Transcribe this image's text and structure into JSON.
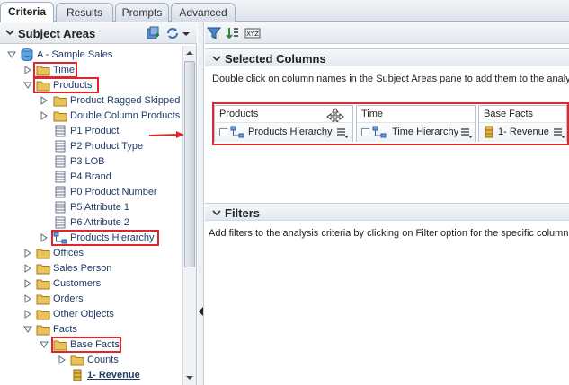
{
  "tabs": [
    {
      "label": "Criteria",
      "active": true
    },
    {
      "label": "Results",
      "active": false
    },
    {
      "label": "Prompts",
      "active": false
    },
    {
      "label": "Advanced",
      "active": false
    }
  ],
  "subject_areas": {
    "title": "Subject Areas",
    "tree": [
      {
        "label": "A - Sample Sales",
        "icon": "subject-area-icon",
        "twisty": "expanded"
      },
      {
        "label": "Time",
        "icon": "folder-icon",
        "twisty": "collapsed"
      },
      {
        "label": "Products",
        "icon": "folder-icon",
        "twisty": "expanded"
      },
      {
        "label": "Product Ragged Skipped L",
        "icon": "folder-icon",
        "twisty": "collapsed"
      },
      {
        "label": "Double Column Products",
        "icon": "folder-icon",
        "twisty": "collapsed"
      },
      {
        "label": "P1 Product",
        "icon": "column-icon",
        "twisty": "none"
      },
      {
        "label": "P2 Product Type",
        "icon": "column-icon",
        "twisty": "none"
      },
      {
        "label": "P3 LOB",
        "icon": "column-icon",
        "twisty": "none"
      },
      {
        "label": "P4 Brand",
        "icon": "column-icon",
        "twisty": "none"
      },
      {
        "label": "P0 Product Number",
        "icon": "column-icon",
        "twisty": "none"
      },
      {
        "label": "P5 Attribute 1",
        "icon": "column-icon",
        "twisty": "none"
      },
      {
        "label": "P6 Attribute 2",
        "icon": "column-icon",
        "twisty": "none"
      },
      {
        "label": "Products Hierarchy",
        "icon": "hierarchy-icon",
        "twisty": "collapsed"
      },
      {
        "label": "Offices",
        "icon": "folder-icon",
        "twisty": "collapsed"
      },
      {
        "label": "Sales Person",
        "icon": "folder-icon",
        "twisty": "collapsed"
      },
      {
        "label": "Customers",
        "icon": "folder-icon",
        "twisty": "collapsed"
      },
      {
        "label": "Orders",
        "icon": "folder-icon",
        "twisty": "collapsed"
      },
      {
        "label": "Other Objects",
        "icon": "folder-icon",
        "twisty": "collapsed"
      },
      {
        "label": "Facts",
        "icon": "folder-icon",
        "twisty": "expanded"
      },
      {
        "label": "Base Facts",
        "icon": "folder-icon",
        "twisty": "expanded"
      },
      {
        "label": "Counts",
        "icon": "folder-icon",
        "twisty": "collapsed"
      },
      {
        "label": "1- Revenue",
        "icon": "measure-icon",
        "twisty": "none"
      }
    ]
  },
  "selected_columns": {
    "title": "Selected Columns",
    "hint": "Double click on column names in the Subject Areas pane to add them to the analysi",
    "columns": [
      {
        "name": "Products",
        "value": "Products Hierarchy"
      },
      {
        "name": "Time",
        "value": "Time Hierarchy"
      },
      {
        "name": "Base Facts",
        "value": "1- Revenue"
      }
    ]
  },
  "filters": {
    "title": "Filters",
    "hint": "Add filters to the analysis criteria by clicking on Filter option for the specific column i"
  },
  "colors": {
    "accent_red": "#e0262a",
    "tree_text": "#1f3b66",
    "folder": "#e9c25a"
  }
}
